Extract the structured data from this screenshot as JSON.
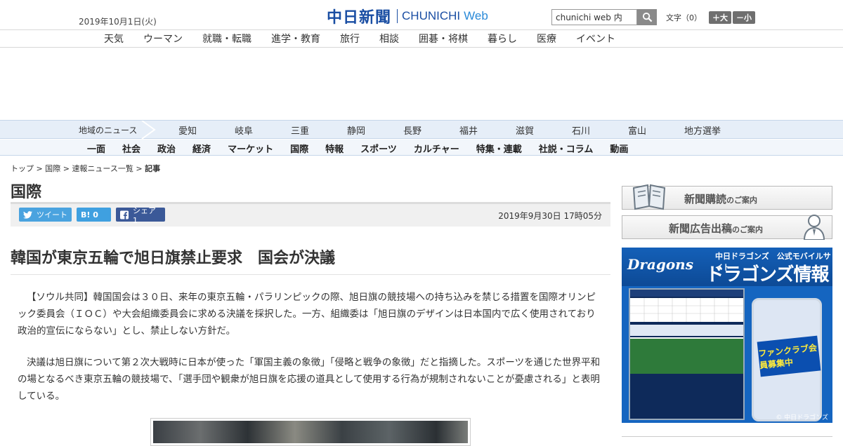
{
  "header": {
    "date": "2019年10月1日(火)",
    "logo_kanji": "中日新聞",
    "logo_en": "CHUNICHI",
    "logo_web": "Web",
    "search_value": "chunichi web 内",
    "font_label": "文字（0）",
    "font_larger": "＋大",
    "font_smaller": "－小"
  },
  "topnav": [
    "天気",
    "ウーマン",
    "就職・転職",
    "進学・教育",
    "旅行",
    "相談",
    "囲碁・将棋",
    "暮らし",
    "医療",
    "イベント"
  ],
  "region": {
    "label": "地域のニュース",
    "items": [
      "愛知",
      "岐阜",
      "三重",
      "静岡",
      "長野",
      "福井",
      "滋賀",
      "石川",
      "富山",
      "地方選挙"
    ]
  },
  "categories": [
    "一面",
    "社会",
    "政治",
    "経済",
    "マーケット",
    "国際",
    "特報",
    "スポーツ",
    "カルチャー",
    "特集・連載",
    "社説・コラム",
    "動画"
  ],
  "breadcrumb": {
    "top": "トップ",
    "intl": "国際",
    "list": "速報ニュース一覧",
    "current": "記事",
    "sep": " > "
  },
  "section_title": "国際",
  "share": {
    "tweet": "ツイート",
    "hatena": "B! 0",
    "facebook": "シェア 1",
    "pubdate": "2019年9月30日 17時05分"
  },
  "article": {
    "headline": "韓国が東京五輪で旭日旗禁止要求　国会が決議",
    "p1": "【ソウル共同】韓国国会は３０日、来年の東京五輪・パラリンピックの際、旭日旗の競技場への持ち込みを禁じる措置を国際オリンピック委員会（ＩＯＣ）や大会組織委員会に求める決議を採択した。一方、組織委は「旭日旗のデザインは日本国内で広く使用されており政治的宣伝にならない」とし、禁止しない方針だ。",
    "p2": "決議は旭日旗について第２次大戦時に日本が使った「軍国主義の象徴」「侵略と戦争の象徴」だと指摘した。スポーツを通じた世界平和の場となるべき東京五輪の競技場で、「選手団や観衆が旭日旗を応援の道具として使用する行為が規制されないことが憂慮される」と表明している。"
  },
  "sidebar": {
    "ad1_main": "新聞購読",
    "ad1_sub": "のご案内",
    "ad2_main": "新聞広告出稿",
    "ad2_sub": "のご案内",
    "dragons_logo": "Dragons",
    "dragons_sub": "中日ドラゴンズ　公式モバイルサイト",
    "dragons_big": "ドラゴンズ情報",
    "dragons_fan": "ファンクラブ会員募集中",
    "dragons_copy": "© 中日ドラゴンズ"
  }
}
